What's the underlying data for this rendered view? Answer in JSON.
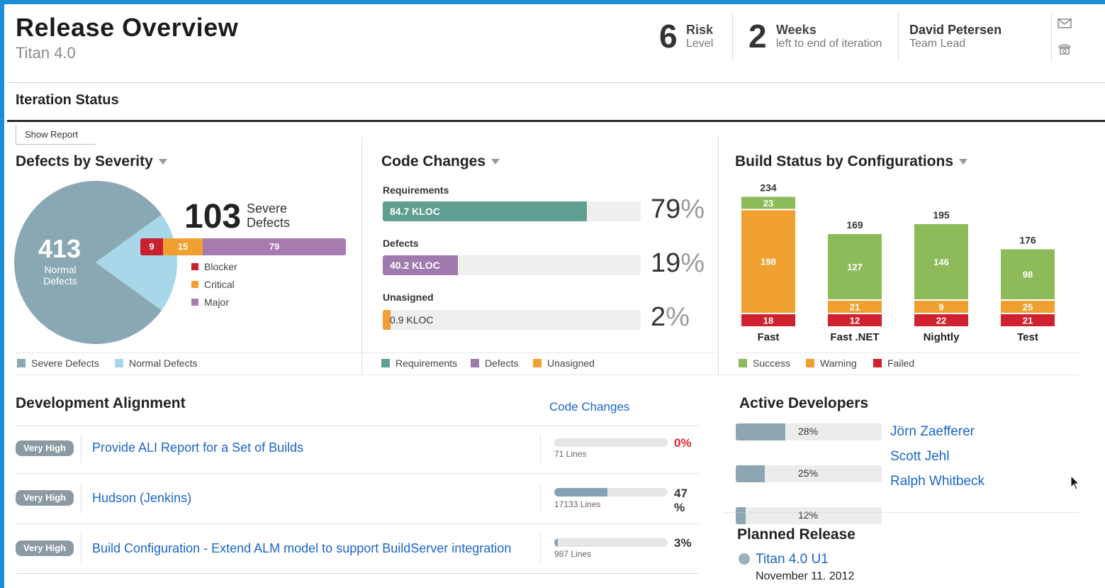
{
  "header": {
    "title": "Release Overview",
    "subtitle": "Titan 4.0",
    "risk": {
      "value": "6",
      "top": "Risk",
      "bottom": "Level"
    },
    "weeks": {
      "value": "2",
      "top": "Weeks",
      "bottom": "left to end of iteration"
    },
    "lead": {
      "name": "David Petersen",
      "role": "Team Lead"
    },
    "icons": [
      "mail-icon",
      "phone-icon"
    ]
  },
  "iteration": {
    "title": "Iteration Status",
    "tab": "Show Report"
  },
  "defects": {
    "title": "Defects by Severity",
    "normal_count": "413",
    "normal_label_1": "Normal",
    "normal_label_2": "Defects",
    "severe_count": "103",
    "severe_label_1": "Severe",
    "severe_label_2": "Defects",
    "breakdown": [
      {
        "label": "Blocker",
        "value": "9",
        "color": "#c8202f"
      },
      {
        "label": "Critical",
        "value": "15",
        "color": "#f0a030"
      },
      {
        "label": "Major",
        "value": "79",
        "color": "#a77bb0"
      }
    ],
    "legend": [
      {
        "label": "Severe Defects",
        "color": "#8aa8b4"
      },
      {
        "label": "Normal Defects",
        "color": "#a9d7ea"
      }
    ],
    "colors": {
      "normal": "#8aa8b4",
      "severe": "#a9d7ea"
    }
  },
  "code_changes": {
    "title": "Code Changes",
    "items": [
      {
        "label": "Requirements",
        "value": "84.7 KLOC",
        "pct_num": "79",
        "pct_sym": "%",
        "fraction": 0.79,
        "color": "#5e9f92"
      },
      {
        "label": "Defects",
        "value": "40.2 KLOC",
        "pct_num": "19",
        "pct_sym": "%",
        "fraction": 0.29,
        "color": "#a07aae"
      },
      {
        "label": "Unasigned",
        "value": "0.9 KLOC",
        "pct_num": "2",
        "pct_sym": "%",
        "fraction": 0.02,
        "color": "#f0a030"
      }
    ],
    "legend": [
      {
        "label": "Requirements",
        "color": "#5e9f92"
      },
      {
        "label": "Defects",
        "color": "#a07aae"
      },
      {
        "label": "Unasigned",
        "color": "#f0a030"
      }
    ]
  },
  "build_status": {
    "title": "Build Status by Configurations",
    "configs": [
      {
        "name": "Fast",
        "total": "234",
        "success": 23,
        "warning": 198,
        "failed": 18
      },
      {
        "name": "Fast .NET",
        "total": "169",
        "success": 127,
        "warning": 21,
        "failed": 12
      },
      {
        "name": "Nightly",
        "total": "195",
        "success": 146,
        "warning": 9,
        "failed": 22
      },
      {
        "name": "Test",
        "total": "176",
        "success": 98,
        "warning": 25,
        "failed": 21
      }
    ],
    "colors": {
      "success": "#8dbb5a",
      "warning": "#f0a030",
      "failed": "#d0222e"
    },
    "legend": [
      {
        "label": "Success",
        "color": "#8dbb5a"
      },
      {
        "label": "Warning",
        "color": "#f0a030"
      },
      {
        "label": "Failed",
        "color": "#d0222e"
      }
    ]
  },
  "dev_alignment": {
    "title": "Development Alignment",
    "code_changes_link": "Code Changes",
    "rows": [
      {
        "priority": "Very High",
        "name": "Provide ALI Report for a Set of Builds",
        "lines": "71 Lines",
        "pct": "0%",
        "pct_color": "#e0262e",
        "fraction": 0
      },
      {
        "priority": "Very High",
        "name": "Hudson (Jenkins)",
        "lines": "17133 Lines",
        "pct": "47\n%",
        "pct_color": "#333333",
        "fraction": 0.47
      },
      {
        "priority": "Very High",
        "name": "Build Configuration - Extend ALM model to support BuildServer integration",
        "lines": "987 Lines",
        "pct": "3%",
        "pct_color": "#333333",
        "fraction": 0.03
      }
    ]
  },
  "active_devs": {
    "title": "Active Developers",
    "devs": [
      {
        "name": "Jörn Zaefferer",
        "pct": "28%",
        "fraction": 0.34
      },
      {
        "name": "Scott Jehl",
        "pct": "25%",
        "fraction": 0.2
      },
      {
        "name": "Ralph Whitbeck",
        "pct": "12%",
        "fraction": 0.07
      }
    ]
  },
  "planned": {
    "title": "Planned Release",
    "name": "Titan 4.0 U1",
    "date": "November 11. 2012"
  }
}
